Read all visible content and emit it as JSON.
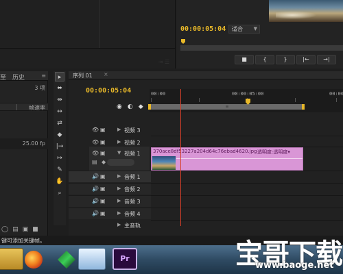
{
  "source_panel": {
    "faint_controls": "⇥ ☰"
  },
  "program": {
    "timecode": "00:00:05:04",
    "fit": "适合",
    "buttons": [
      "■",
      "{",
      "}",
      "|←",
      "→|"
    ]
  },
  "project": {
    "history_tab": "历史",
    "label_tab": "至",
    "menu_icon": "≡",
    "count": "3 项",
    "column": "帧速率",
    "fps": "25.00 fp",
    "bottom_icons": [
      "◯",
      "▤",
      "▣",
      "■"
    ]
  },
  "tools": [
    "▸",
    "⬌",
    "⇹",
    "↔",
    "⇄",
    "◆",
    "|→",
    "↦",
    "✎",
    "✋",
    "⌕"
  ],
  "timeline": {
    "tab": "序列 01",
    "tab_close": "×",
    "timecode": "00:00:05:04",
    "controls": [
      "◉",
      "◐",
      "◆"
    ],
    "ruler_labels": [
      "00:00",
      "00:00:05:00",
      "00:00"
    ],
    "tracks": [
      {
        "name": "视频 3",
        "kind": "video"
      },
      {
        "name": "视频 2",
        "kind": "video"
      },
      {
        "name": "视频 1",
        "kind": "video"
      },
      {
        "name": "音频 1",
        "kind": "audio"
      },
      {
        "name": "音频 2",
        "kind": "audio"
      },
      {
        "name": "音频 3",
        "kind": "audio"
      },
      {
        "name": "音频 4",
        "kind": "audio"
      },
      {
        "name": "主音轨",
        "kind": "master"
      }
    ],
    "clip": {
      "name": "370ace8df53227a204d64c76ebad4620.jpg",
      "opacity": "透明度:透明度▾"
    }
  },
  "status": "键可添加关键帧。",
  "taskbar": {
    "pr_label": "Pr"
  },
  "watermark": {
    "main": "宝哥下载",
    "url": "www.baoge.net"
  }
}
